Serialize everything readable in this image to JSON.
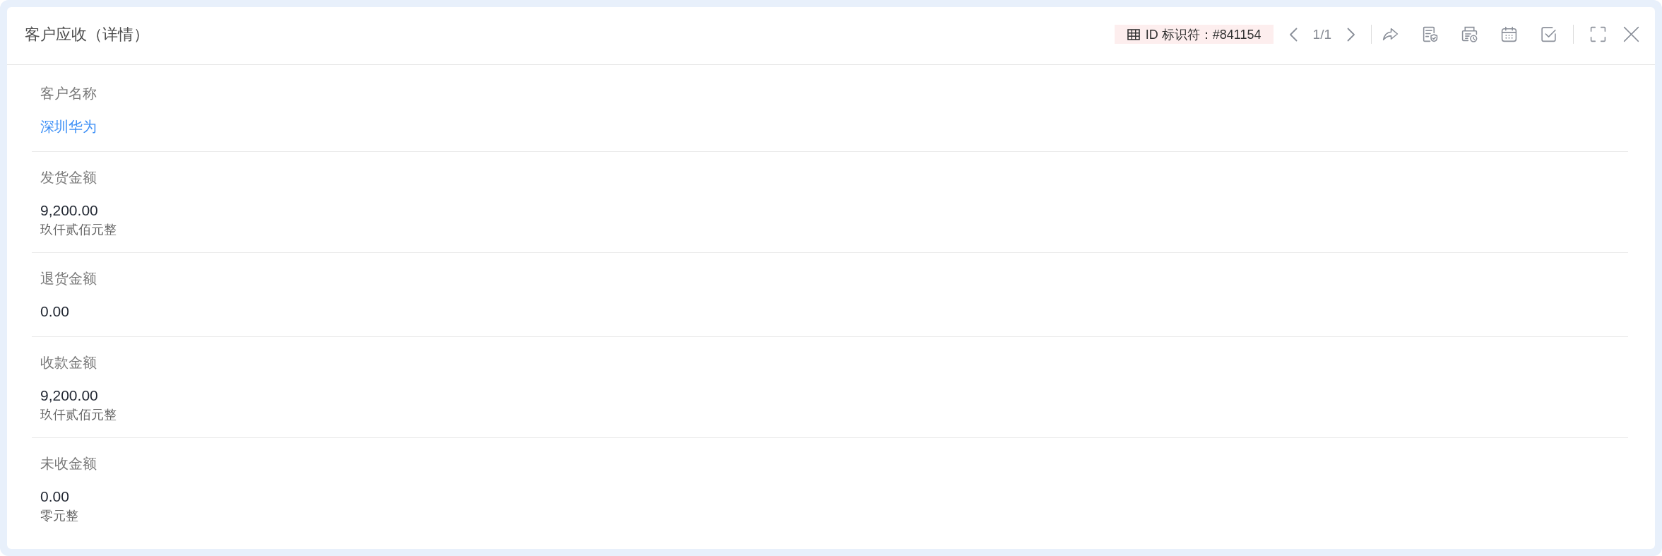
{
  "window": {
    "title": "客户应收（详情）"
  },
  "toolbar": {
    "id_badge": "ID 标识符：#841154",
    "page": "1/1"
  },
  "fields": [
    {
      "kind": "link",
      "label": "客户名称",
      "value": "深圳华为"
    },
    {
      "kind": "amount",
      "label": "发货金额",
      "value": "9,200.00",
      "caption": "玖仟贰佰元整"
    },
    {
      "kind": "amount",
      "label": "退货金额",
      "value": "0.00"
    },
    {
      "kind": "amount",
      "label": "收款金额",
      "value": "9,200.00",
      "caption": "玖仟贰佰元整"
    },
    {
      "kind": "amount",
      "label": "未收金额",
      "value": "0.00",
      "caption": "零元整"
    }
  ]
}
